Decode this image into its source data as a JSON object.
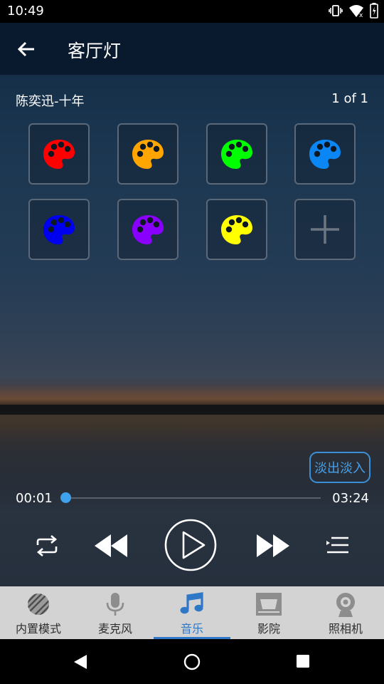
{
  "status": {
    "time": "10:49"
  },
  "header": {
    "title": "客厅灯"
  },
  "song": {
    "name": "陈奕迅-十年",
    "pages": "1 of 1"
  },
  "colors": [
    {
      "name": "red-palette-icon",
      "hex": "#ff0000"
    },
    {
      "name": "orange-palette-icon",
      "hex": "#ffa500"
    },
    {
      "name": "green-palette-icon",
      "hex": "#00ff00"
    },
    {
      "name": "sky-blue-palette-icon",
      "hex": "#0a87f5"
    },
    {
      "name": "blue-palette-icon",
      "hex": "#0000f0"
    },
    {
      "name": "purple-palette-icon",
      "hex": "#8a00ff"
    },
    {
      "name": "yellow-palette-icon",
      "hex": "#ffff00"
    }
  ],
  "fade": {
    "label": "淡出淡入"
  },
  "player": {
    "current": "00:01",
    "total": "03:24",
    "progress": 0.005
  },
  "tabs": [
    {
      "label": "内置模式",
      "icon": "stripes-icon"
    },
    {
      "label": "麦克风",
      "icon": "microphone-icon"
    },
    {
      "label": "音乐",
      "icon": "music-note-icon",
      "active": true
    },
    {
      "label": "影院",
      "icon": "cinema-icon"
    },
    {
      "label": "照相机",
      "icon": "webcam-icon"
    }
  ],
  "accent": "#2f78c8"
}
